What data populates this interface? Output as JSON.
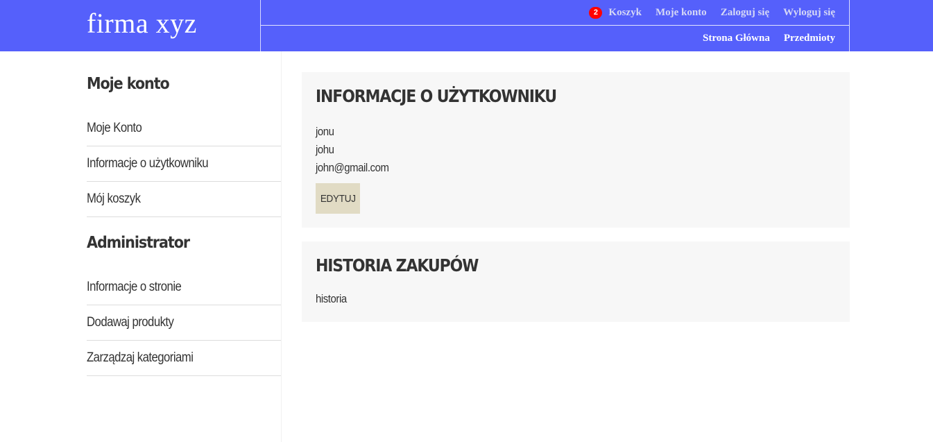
{
  "header": {
    "logo": "firma xyz",
    "cart_badge": "2",
    "top_nav": [
      {
        "label": "Koszyk"
      },
      {
        "label": "Moje konto"
      },
      {
        "label": "Zaloguj się"
      },
      {
        "label": "Wyloguj się"
      }
    ],
    "bottom_nav": [
      {
        "label": "Strona Główna"
      },
      {
        "label": "Przedmioty"
      }
    ],
    "colors": {
      "bar": "#5560fb",
      "badge": "#ff0000"
    }
  },
  "sidebar": {
    "account_heading": "Moje konto",
    "account_items": [
      {
        "label": "Moje Konto"
      },
      {
        "label": "Informacje o użytkowniku"
      },
      {
        "label": "Mój koszyk"
      }
    ],
    "admin_heading": "Administrator",
    "admin_items": [
      {
        "label": "Informacje o stronie"
      },
      {
        "label": "Dodawaj produkty"
      },
      {
        "label": "Zarządzaj kategoriami"
      }
    ]
  },
  "user_info": {
    "title": "INFORMACJE O UŻYTKOWNIKU",
    "lines": [
      "jonu",
      "johu",
      "john@gmail.com"
    ],
    "edit_label": "EDYTUJ"
  },
  "history": {
    "title": "HISTORIA ZAKUPÓW",
    "text": "historia"
  }
}
